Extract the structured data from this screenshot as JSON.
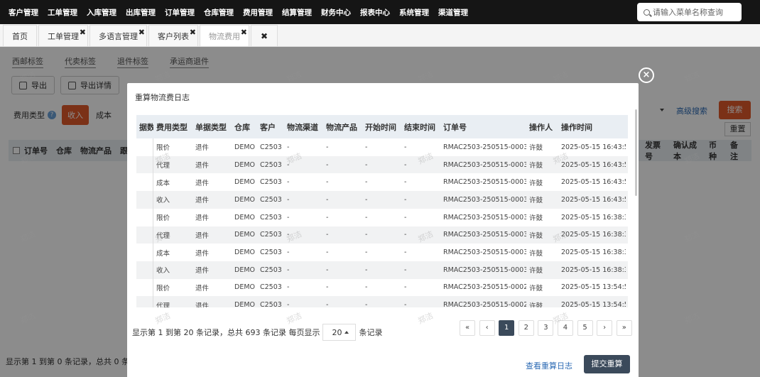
{
  "topnav": {
    "menu": [
      "客户管理",
      "工单管理",
      "入库管理",
      "出库管理",
      "订单管理",
      "仓库管理",
      "费用管理",
      "结算管理",
      "财务中心",
      "报表中心",
      "系统管理",
      "渠道管理"
    ],
    "search_placeholder": "请输入菜单名称查询"
  },
  "tabs": [
    {
      "label": "首页",
      "closable": false
    },
    {
      "label": "工单管理",
      "closable": true
    },
    {
      "label": "多语言管理",
      "closable": true
    },
    {
      "label": "客户列表",
      "closable": true
    },
    {
      "label": "物流费用",
      "closable": true,
      "active": true
    }
  ],
  "tabs_close_all": "✖",
  "background": {
    "subtabs": [
      "西邮标签",
      "代卖标签",
      "退件标签",
      "承运商退件"
    ],
    "buttons": [
      "导出",
      "导出详情"
    ],
    "filter_label": "费用类型",
    "filter_income": "收入",
    "filter_cost": "成本",
    "advanced_search": "高级搜索",
    "search": "搜索",
    "reset": "重置",
    "columns_left": [
      "订单号",
      "仓库",
      "物流产品",
      "跟"
    ],
    "columns_right": [
      "发票号",
      "确认成本",
      "币种",
      "备注"
    ],
    "footer": "显示第 1 到第 0 条记录，总共 0 条记"
  },
  "modal": {
    "title": "重算物流费日志",
    "columns": [
      "据数",
      "费用类型",
      "单据类型",
      "仓库",
      "客户",
      "物流渠道",
      "物流产品",
      "开始时间",
      "结束时间",
      "订单号",
      "操作人",
      "操作时间"
    ],
    "rows": [
      [
        "",
        "限价",
        "退件",
        "DEMO",
        "C2503",
        "-",
        "-",
        "-",
        "-",
        "RMAC2503-250515-0003",
        "许鼓",
        "2025-05-15 16:43:57"
      ],
      [
        "",
        "代理",
        "退件",
        "DEMO",
        "C2503",
        "-",
        "-",
        "-",
        "-",
        "RMAC2503-250515-0003",
        "许鼓",
        "2025-05-15 16:43:57"
      ],
      [
        "",
        "成本",
        "退件",
        "DEMO",
        "C2503",
        "-",
        "-",
        "-",
        "-",
        "RMAC2503-250515-0003",
        "许鼓",
        "2025-05-15 16:43:57"
      ],
      [
        "",
        "收入",
        "退件",
        "DEMO",
        "C2503",
        "-",
        "-",
        "-",
        "-",
        "RMAC2503-250515-0003",
        "许鼓",
        "2025-05-15 16:43:57"
      ],
      [
        "",
        "限价",
        "退件",
        "DEMO",
        "C2503",
        "-",
        "-",
        "-",
        "-",
        "RMAC2503-250515-0003",
        "许鼓",
        "2025-05-15 16:38:37"
      ],
      [
        "",
        "代理",
        "退件",
        "DEMO",
        "C2503",
        "-",
        "-",
        "-",
        "-",
        "RMAC2503-250515-0003",
        "许鼓",
        "2025-05-15 16:38:37"
      ],
      [
        "",
        "成本",
        "退件",
        "DEMO",
        "C2503",
        "-",
        "-",
        "-",
        "-",
        "RMAC2503-250515-0003",
        "许鼓",
        "2025-05-15 16:38:37"
      ],
      [
        "",
        "收入",
        "退件",
        "DEMO",
        "C2503",
        "-",
        "-",
        "-",
        "-",
        "RMAC2503-250515-0003",
        "许鼓",
        "2025-05-15 16:38:37"
      ],
      [
        "",
        "限价",
        "退件",
        "DEMO",
        "C2503",
        "-",
        "-",
        "-",
        "-",
        "RMAC2503-250515-0002",
        "许鼓",
        "2025-05-15 13:54:55"
      ],
      [
        "",
        "代理",
        "退件",
        "DEMO",
        "C2503",
        "-",
        "-",
        "-",
        "-",
        "RMAC2503-250515-0002",
        "许鼓",
        "2025-05-15 13:54:55"
      ]
    ],
    "pagination": {
      "info_prefix": "显示第 1 到第 20 条记录，总共 693 条记录 每页显示",
      "page_size": "20",
      "info_suffix": "条记录",
      "first": "«",
      "prev": "‹",
      "pages": [
        "1",
        "2",
        "3",
        "4",
        "5"
      ],
      "current": "1",
      "next": "›",
      "last": "»"
    },
    "view_log": "查看重算日志",
    "submit": "提交重算"
  },
  "watermark": "郑洁"
}
